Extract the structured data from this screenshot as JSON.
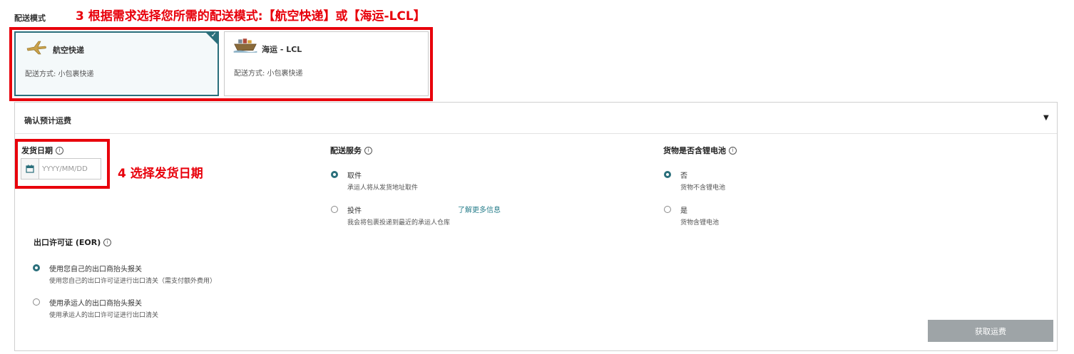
{
  "shipping_mode": {
    "section_label": "配送模式",
    "options": [
      {
        "title": "航空快递",
        "subtitle": "配送方式: 小包裹快递",
        "selected": true,
        "icon": "airplane-icon"
      },
      {
        "title": "海运 - LCL",
        "subtitle": "配送方式: 小包裹快递",
        "selected": false,
        "icon": "ship-icon"
      }
    ]
  },
  "annotations": {
    "step3": "3 根据需求选择您所需的配送模式:【航空快递】或【海运-LCL】",
    "step4": "4 选择发货日期"
  },
  "estimate": {
    "title": "确认预计运费",
    "ship_date": {
      "label": "发货日期",
      "placeholder": "YYYY/MM/DD"
    },
    "delivery_service": {
      "label": "配送服务",
      "options": [
        {
          "title": "取件",
          "desc": "承运人将从发货地址取件",
          "selected": true
        },
        {
          "title": "投件",
          "desc": "我会将包裹投递到最近的承运人仓库",
          "selected": false
        }
      ],
      "learn_more": "了解更多信息"
    },
    "battery": {
      "label": "货物是否含锂电池",
      "options": [
        {
          "title": "否",
          "desc": "货物不含锂电池",
          "selected": true
        },
        {
          "title": "是",
          "desc": "货物含锂电池",
          "selected": false
        }
      ]
    },
    "eor": {
      "label": "出口许可证 (EOR)",
      "options": [
        {
          "title": "使用您自己的出口商抬头报关",
          "desc": "使用您自己的出口许可证进行出口清关（需支付额外费用）",
          "selected": true
        },
        {
          "title": "使用承运人的出口商抬头报关",
          "desc": "使用承运人的出口许可证进行出口清关",
          "selected": false
        }
      ]
    },
    "get_quote": "获取运费"
  },
  "colors": {
    "accent": "#2a6f7b",
    "annotation": "#e8000b",
    "button_disabled": "#9ea4a7"
  }
}
